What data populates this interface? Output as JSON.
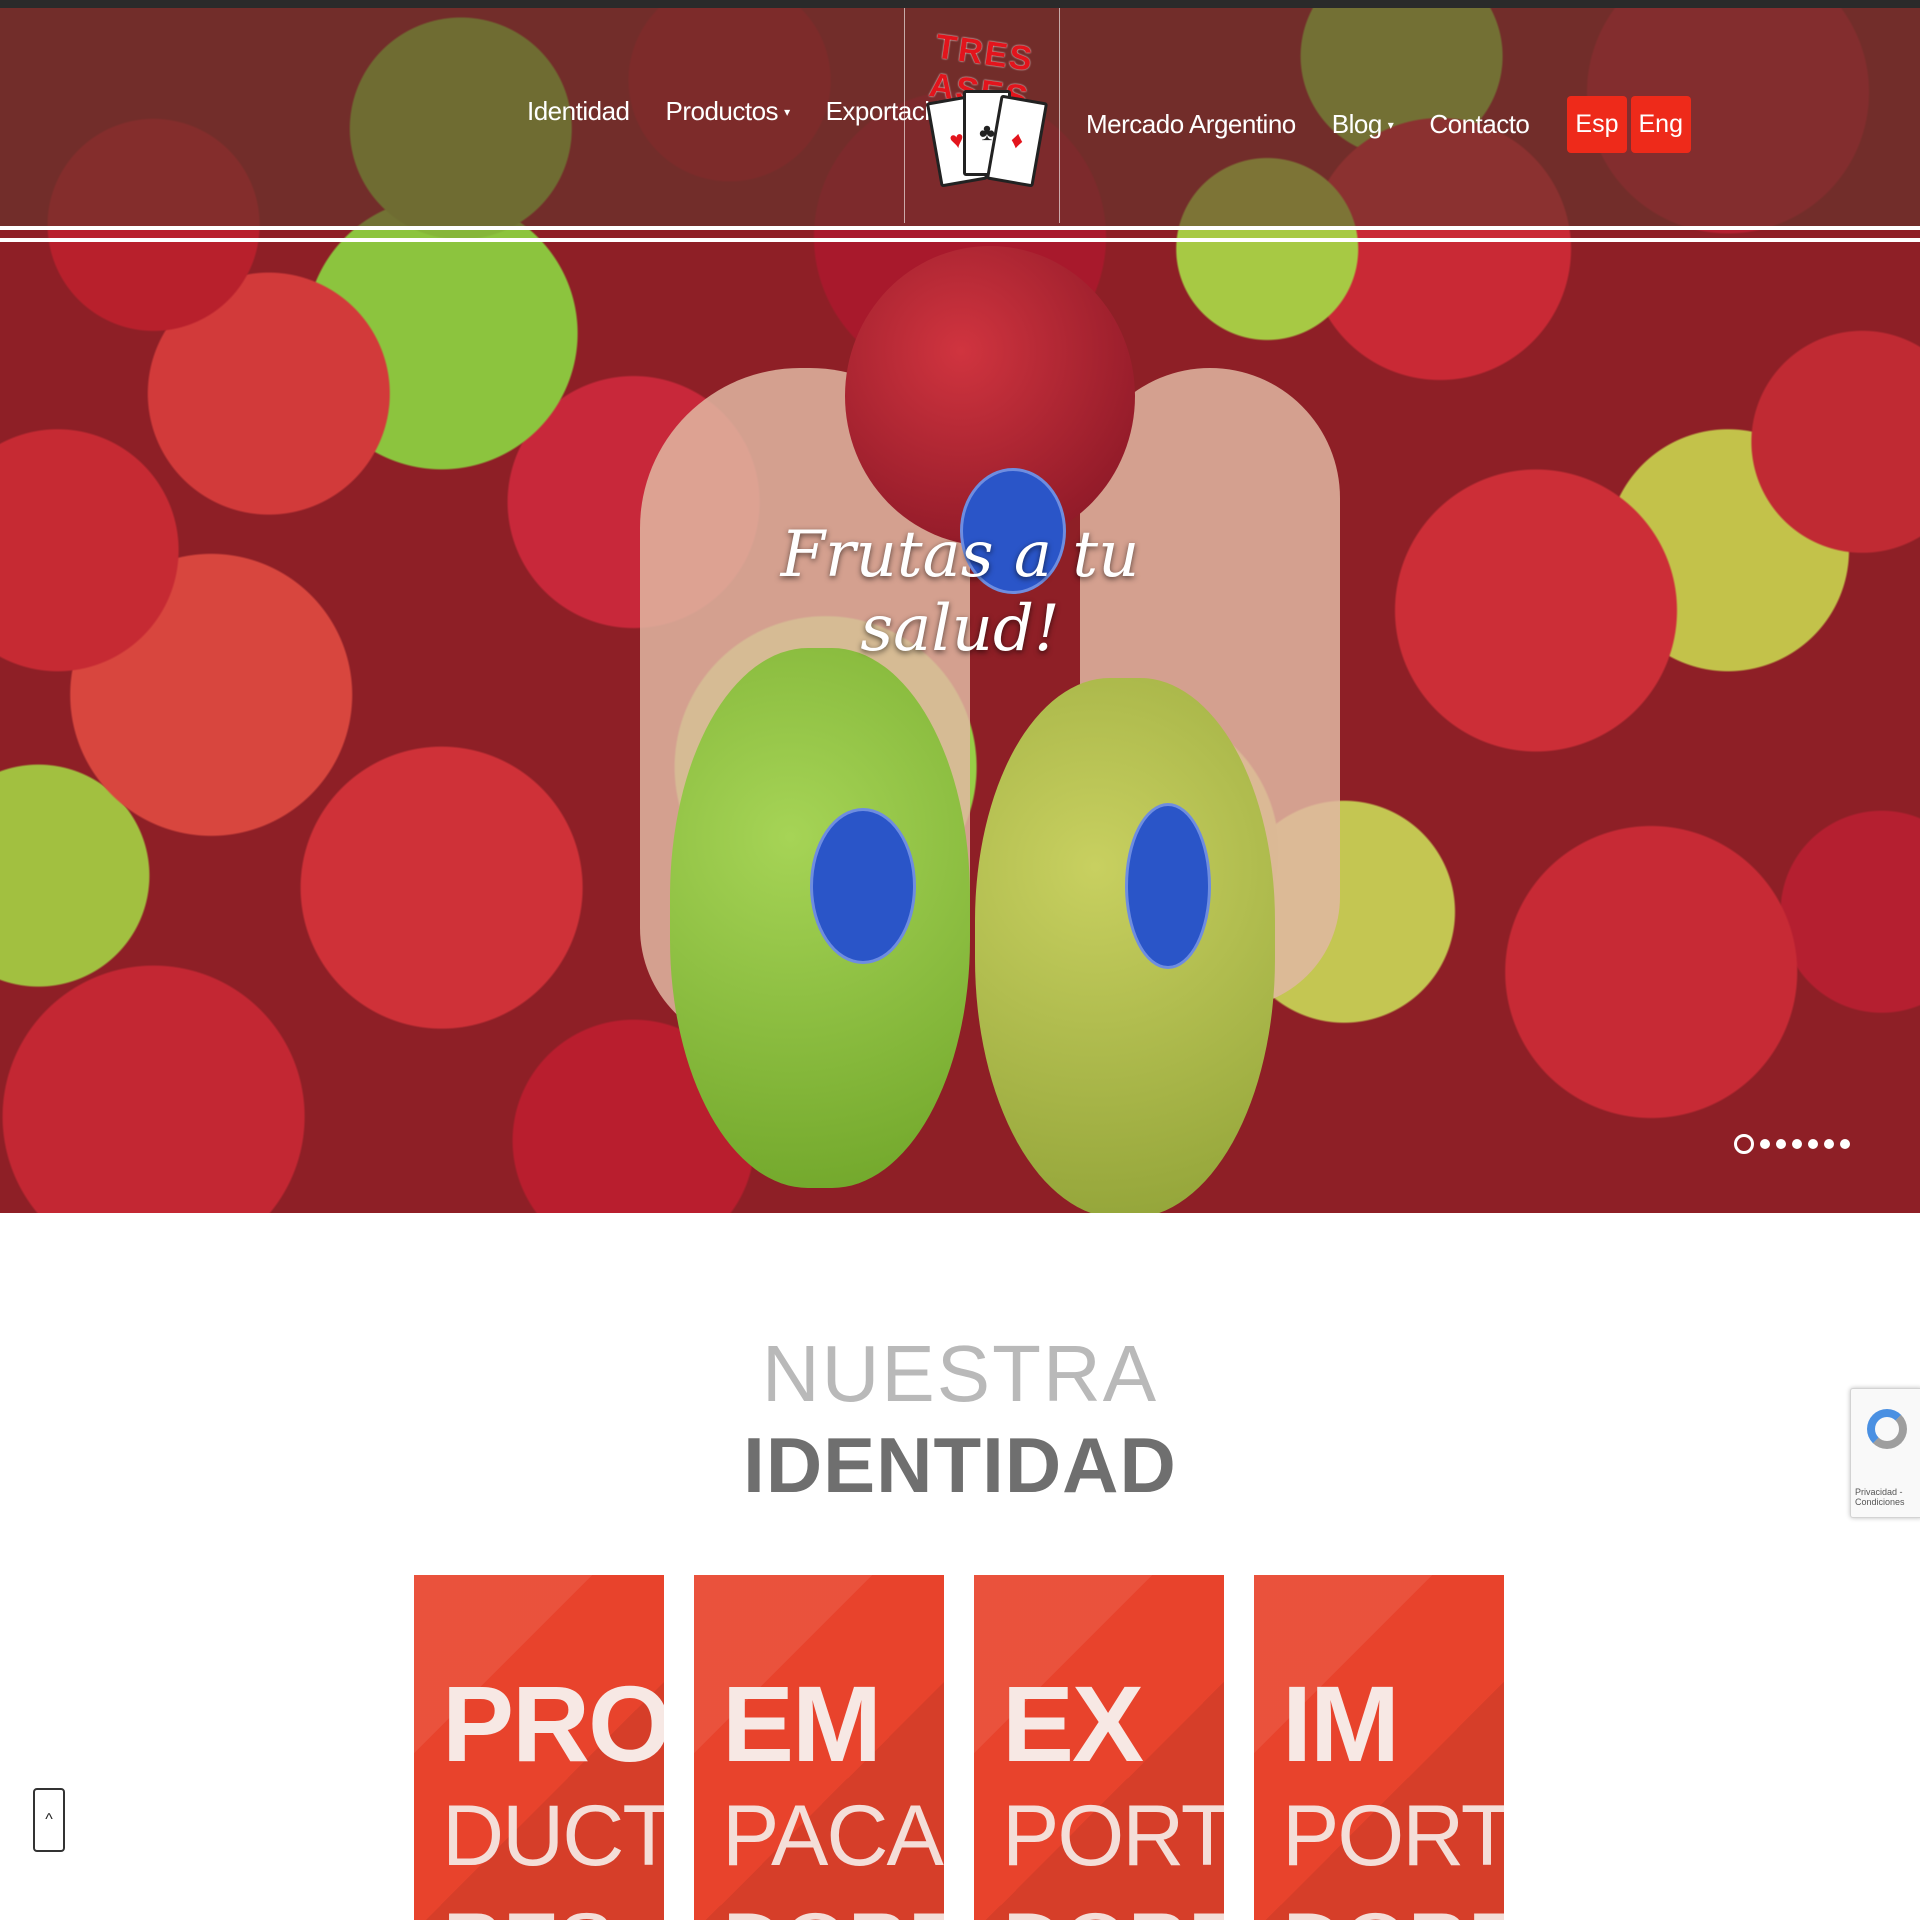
{
  "nav": {
    "left_items": [
      {
        "label": "Identidad",
        "has_dropdown": false
      },
      {
        "label": "Productos",
        "has_dropdown": true
      },
      {
        "label": "Exportación",
        "has_dropdown": false
      }
    ],
    "right_items": [
      {
        "label": "Mercado Argentino",
        "has_dropdown": false
      },
      {
        "label": "Blog",
        "has_dropdown": true
      },
      {
        "label": "Contacto",
        "has_dropdown": false
      }
    ],
    "languages": [
      "Esp",
      "Eng"
    ],
    "dropdown_caret": "▾"
  },
  "logo": {
    "brand": "TRES ASES",
    "card_suits": [
      "♥",
      "♣",
      "♦"
    ],
    "brand_color": "#e3141c"
  },
  "hero": {
    "tagline": "Frutas a tu salud!",
    "slides_total": 7,
    "active_slide": 1
  },
  "identity": {
    "subtitle": "NUESTRA",
    "title": "IDENTIDAD",
    "tiles": [
      {
        "top": "PRO",
        "middle": "DUCTO",
        "bottom": "RES"
      },
      {
        "top": "EM",
        "middle": "PACA",
        "bottom": "DORES"
      },
      {
        "top": "EX",
        "middle": "PORTA",
        "bottom": "DORES"
      },
      {
        "top": "IM",
        "middle": "PORTA",
        "bottom": "DORES"
      }
    ]
  },
  "recaptcha": {
    "label": "Privacidad - Condiciones"
  },
  "scroll_top": {
    "icon": "^"
  },
  "colors": {
    "accent": "#ee2a1a",
    "tile": "#e8432c",
    "title_gray": "#6f6f6f",
    "subtitle_gray": "#b9b9b9"
  }
}
